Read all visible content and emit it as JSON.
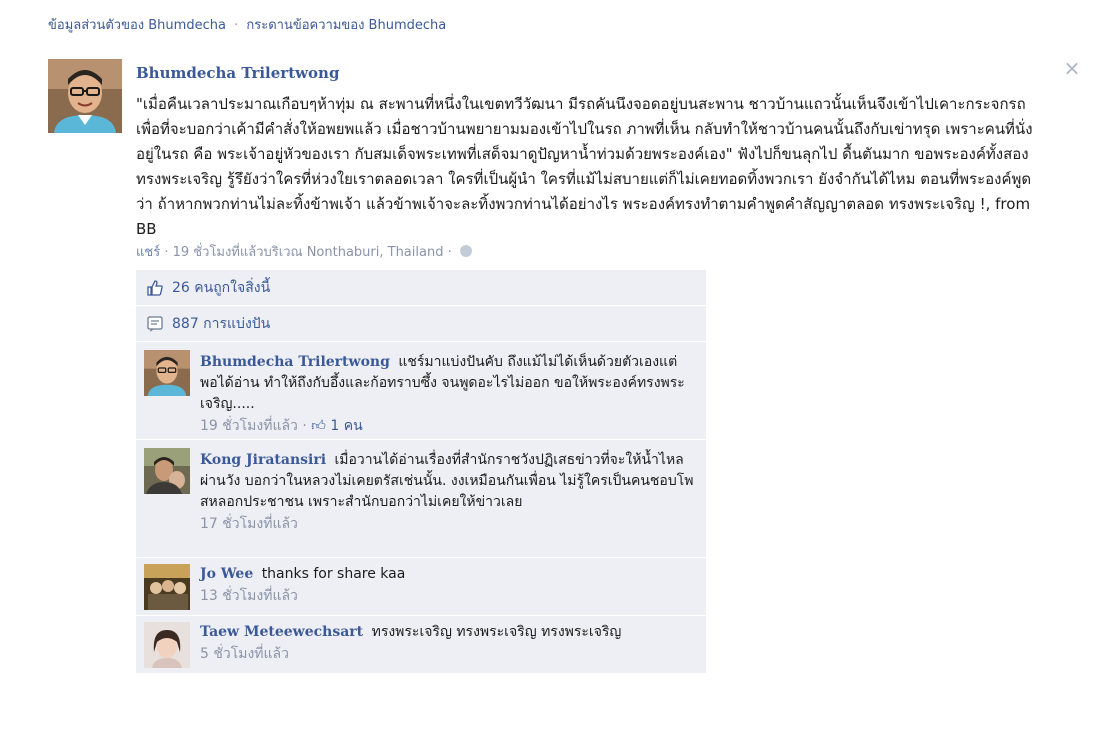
{
  "breadcrumb": {
    "profile_link": "ข้อมูลส่วนตัวของ Bhumdecha",
    "separator": "·",
    "wall_link": "กระดานข้อความของ Bhumdecha"
  },
  "post": {
    "author": "Bhumdecha Trilertwong",
    "text": "\"เมื่อคืนเวลาประมาณเกือบๆห้าทุ่ม ณ สะพานที่หนึ่งในเขตทวีวัฒนา มีรถคันนึงจอดอยู่บนสะพาน ชาวบ้านแถวนั้นเห็นจึงเข้าไปเคาะกระจกรถเพื่อที่จะบอกว่าเค้ามีคำสั่งให้อพยพแล้ว เมื่อชาวบ้านพยายามมองเข้าไปในรถ ภาพที่เห็น กลับทำให้ชาวบ้านคนนั้นถึงกับเข่าทรุด เพราะคนที่นั่งอยู่ในรถ คือ พระเจ้าอยู่หัวของเรา กับสมเด็จพระเทพที่เสด็จมาดูปัญหาน้ำท่วมด้วยพระองค์เอง\" ฟังไปก็ขนลุกไป ดื้นตันมาก ขอพระองค์ทั้งสองทรงพระเจริญ รู้รึยังว่าใครที่ห่วงใยเราตลอดเวลา ใครที่เป็นผู้นำ ใครที่แม้ไม่สบายแต่ก็ไม่เคยทอดทิ้งพวกเรา ยังจำกันได้ไหม ตอนที่พระองค์พูดว่า ถ้าหากพวกท่านไม่ละทิ้งข้าพเจ้า แล้วข้าพเจ้าจะละทิ้งพวกท่านได้อย่างไร พระองค์ทรงทำตามคำพูดคำสัญญาตลอด ทรงพระเจริญ !, from BB",
    "share_link": "แชร์",
    "meta_dot": "·",
    "meta_time_location": "19 ชั่วโมงที่แล้วบริเวณ Nonthaburi, Thailand",
    "meta_dot2": "·"
  },
  "feedback": {
    "likes_text": "26 คนถูกใจสิ่งนี้",
    "shares_text": "887 การแบ่งปัน"
  },
  "comments": [
    {
      "author": "Bhumdecha Trilertwong",
      "text": "แชร์มาแบ่งปันคับ ถึงแม้ไม่ได้เห็นด้วยตัวเองแต่พอได้อ่าน ทำให้ถึงกับอึ้งและก้อทราบซึ้ง จนพูดอะไรไม่ออก ขอให้พระองค์ทรงพระเจริญ.....",
      "time": "19 ชั่วโมงที่แล้ว",
      "dot": "·",
      "likes": "1 คน"
    },
    {
      "author": "Kong Jiratansiri",
      "text": "เมื่อวานได้อ่านเรื่องที่สำนักราชวังปฏิเสธข่าวที่จะให้น้ำไหลผ่านวัง บอกว่าในหลวงไม่เคยตรัสเช่นนั้น. งงเหมือนกันเพื่อน ไม่รู้ใครเป็นคนชอบโพสหลอกประชาชน เพราะสำนักบอกว่าไม่เคยให้ข่าวเลย",
      "time": "17 ชั่วโมงที่แล้ว"
    },
    {
      "author": "Jo Wee",
      "text": "thanks for share kaa",
      "time": "13 ชั่วโมงที่แล้ว"
    },
    {
      "author": "Taew Meteewechsart",
      "text": "ทรงพระเจริญ ทรงพระเจริญ ทรงพระเจริญ",
      "time": "5 ชั่วโมงที่แล้ว"
    }
  ],
  "close_label": "×",
  "colors": {
    "link": "#3b5998",
    "panel_bg": "#edeff4",
    "meta": "#8a93a8"
  },
  "icons": [
    "close-icon",
    "like-icon",
    "share-icon",
    "globe-icon"
  ]
}
